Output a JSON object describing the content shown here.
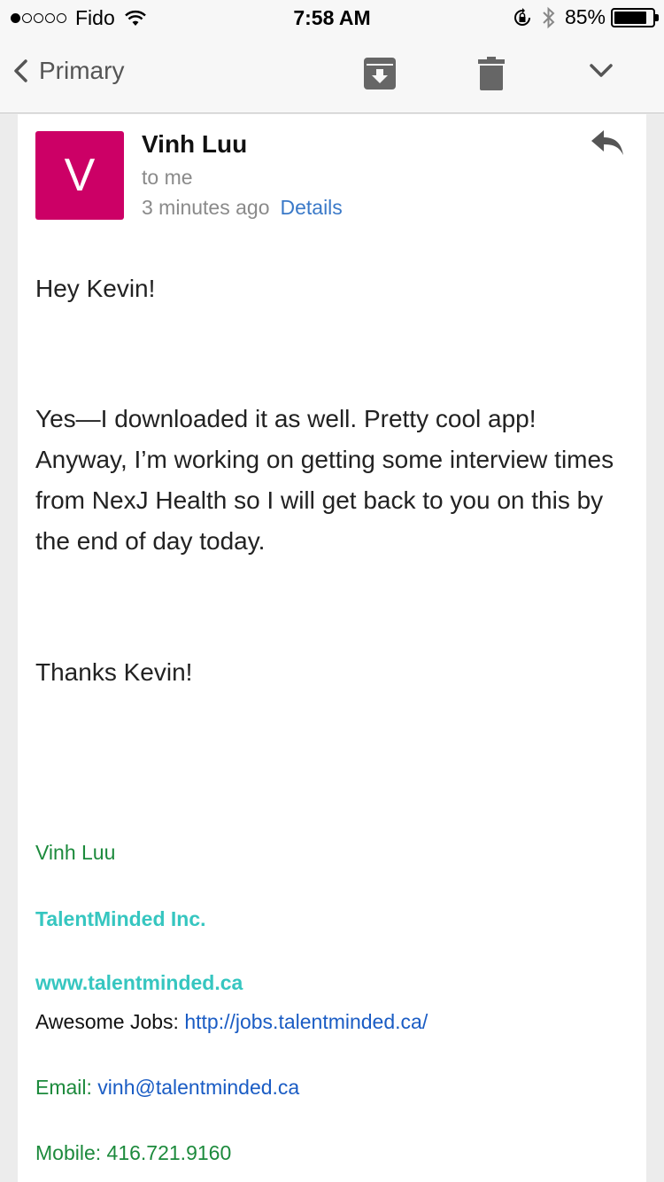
{
  "status_bar": {
    "carrier": "Fido",
    "signal_filled": 1,
    "signal_total": 5,
    "time": "7:58 AM",
    "battery_percent_text": "85%",
    "battery_level": 0.85
  },
  "nav": {
    "back_label": "Primary",
    "icons": [
      "chevron-left-icon",
      "archive-icon",
      "trash-icon",
      "chevron-down-icon"
    ]
  },
  "email": {
    "avatar_letter": "V",
    "avatar_color": "#cc0066",
    "sender": "Vinh Luu",
    "recipient": "to me",
    "time_ago": "3 minutes ago",
    "details_label": "Details",
    "greeting": "Hey Kevin!",
    "paragraph": "Yes—I downloaded it as well. Pretty cool app! Anyway, I’m working on getting some interview times from NexJ Health so I will get back to you on this by the end of day today.",
    "closing": "Thanks Kevin!"
  },
  "signature": {
    "name": "Vinh Luu",
    "company": "TalentMinded Inc.",
    "website": "www.talentminded.ca",
    "jobs_label": "Awesome Jobs: ",
    "jobs_url": "http://jobs.talentminded.ca/",
    "email_label": "Email: ",
    "email_value": "vinh@talentminded.ca",
    "mobile": "Mobile: 416.721.9160"
  },
  "colors": {
    "link_blue": "#3a79c8",
    "signature_green": "#1c8a3c",
    "signature_teal": "#36c6c0"
  }
}
